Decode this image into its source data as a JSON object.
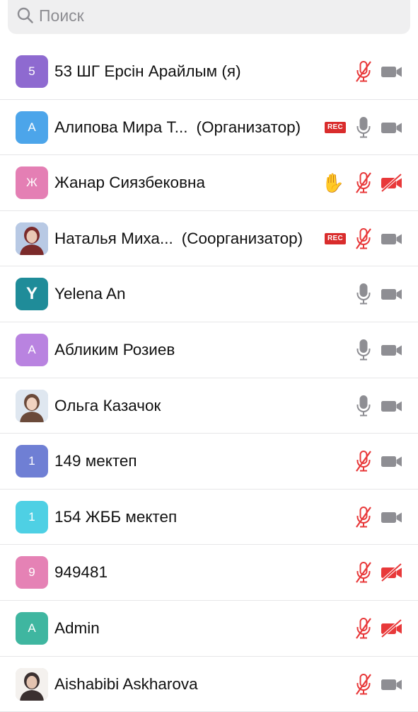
{
  "search": {
    "placeholder": "Поиск"
  },
  "colors": {
    "muted_red": "#e8393a",
    "icon_gray": "#8e8e93"
  },
  "participants": [
    {
      "avatar_letter": "5",
      "avatar_color": "#8e6ad0",
      "name": "53 ШГ Ерсін Арайлым (я)",
      "role": "",
      "rec": false,
      "hand": false,
      "mic": "muted",
      "video": "on"
    },
    {
      "avatar_letter": "А",
      "avatar_color": "#4ca5ea",
      "name": "Алипова Мира Т...",
      "role": "(Организатор)",
      "rec": true,
      "rec_label": "REC",
      "hand": false,
      "mic": "on",
      "video": "on"
    },
    {
      "avatar_letter": "Ж",
      "avatar_color": "#e47fb4",
      "name": "Жанар Сиязбековна",
      "role": "",
      "rec": false,
      "hand": true,
      "mic": "muted",
      "video": "off"
    },
    {
      "avatar_letter": "",
      "avatar_color": "#7aa3d8",
      "avatar_photo": true,
      "name": "Наталья Миха...",
      "role": "(Соорганизатор)",
      "rec": true,
      "rec_label": "REC",
      "hand": false,
      "mic": "muted",
      "video": "on"
    },
    {
      "avatar_letter": "Y",
      "avatar_color": "#1f8c99",
      "big": true,
      "name": "Yelena An",
      "role": "",
      "rec": false,
      "hand": false,
      "mic": "on",
      "video": "on"
    },
    {
      "avatar_letter": "А",
      "avatar_color": "#b983e0",
      "name": "Абликим Розиев",
      "role": "",
      "rec": false,
      "hand": false,
      "mic": "on",
      "video": "on"
    },
    {
      "avatar_letter": "",
      "avatar_color": "#c9d6e6",
      "avatar_photo": true,
      "name": "Ольга Казачок",
      "role": "",
      "rec": false,
      "hand": false,
      "mic": "on",
      "video": "on"
    },
    {
      "avatar_letter": "1",
      "avatar_color": "#6f7fd4",
      "name": "149 мектеп",
      "role": "",
      "rec": false,
      "hand": false,
      "mic": "muted",
      "video": "on"
    },
    {
      "avatar_letter": "1",
      "avatar_color": "#4ed0e4",
      "name": "154 ЖББ мектеп",
      "role": "",
      "rec": false,
      "hand": false,
      "mic": "muted",
      "video": "on"
    },
    {
      "avatar_letter": "9",
      "avatar_color": "#e582b5",
      "name": "949481",
      "role": "",
      "rec": false,
      "hand": false,
      "mic": "muted",
      "video": "off"
    },
    {
      "avatar_letter": "A",
      "avatar_color": "#3fb6a0",
      "name": "Admin",
      "role": "",
      "rec": false,
      "hand": false,
      "mic": "muted",
      "video": "off"
    },
    {
      "avatar_letter": "",
      "avatar_color": "#d8d4d0",
      "avatar_photo": true,
      "name": "Aishabibi Askharova",
      "role": "",
      "rec": false,
      "hand": false,
      "mic": "muted",
      "video": "on"
    }
  ]
}
